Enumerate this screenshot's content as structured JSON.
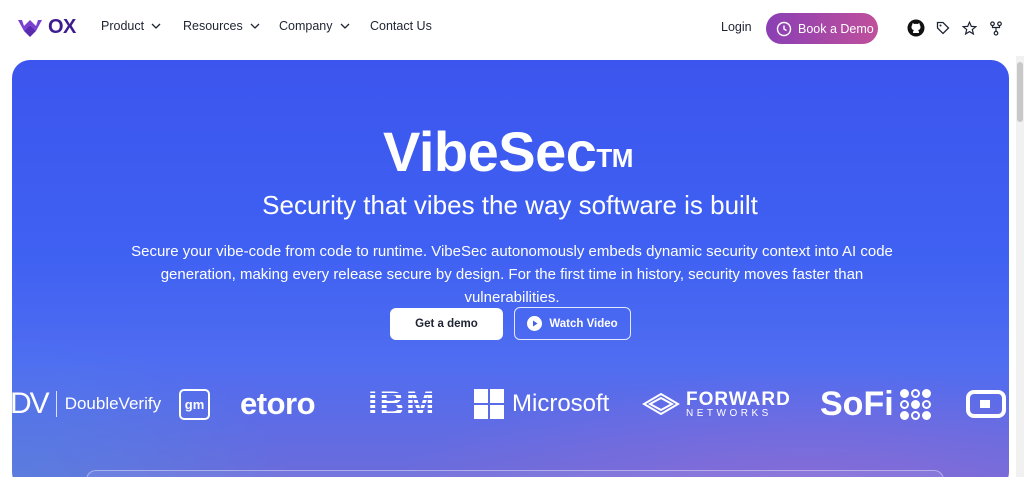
{
  "nav": {
    "brand": "OX",
    "items": [
      {
        "label": "Product",
        "has_dropdown": true
      },
      {
        "label": "Resources",
        "has_dropdown": true
      },
      {
        "label": "Company",
        "has_dropdown": true
      },
      {
        "label": "Contact Us",
        "has_dropdown": false
      }
    ],
    "login_label": "Login",
    "demo_label": "Book a Demo"
  },
  "toolbar_icons": [
    "github-icon",
    "tag-icon",
    "star-icon",
    "fork-icon"
  ],
  "hero": {
    "title": "VibeSec",
    "title_mark": "TM",
    "subtitle": "Security that vibes the way software is built",
    "description_line1": "Secure your vibe-code from code to runtime. VibeSec autonomously embeds dynamic security context into AI code",
    "description_line2": "generation, making every release secure by design. For the first time in history, security moves faster than vulnerabilities.",
    "primary_cta": "Get a demo",
    "secondary_cta": "Watch Video"
  },
  "logos": {
    "doubleverify_mark": "DV",
    "doubleverify": "DoubleVerify",
    "gm": "gm",
    "etoro": "etoro",
    "ibm": "IBM",
    "microsoft": "Microsoft",
    "forward_top": "FORWARD",
    "forward_bottom": "NETWORKS",
    "sofi": "SoFi"
  },
  "colors": {
    "brand_purple": "#3c1c8f",
    "hero_blue": "#3f5ff0",
    "demo_gradient_start": "#8a3fb5",
    "demo_gradient_end": "#c0509b"
  }
}
